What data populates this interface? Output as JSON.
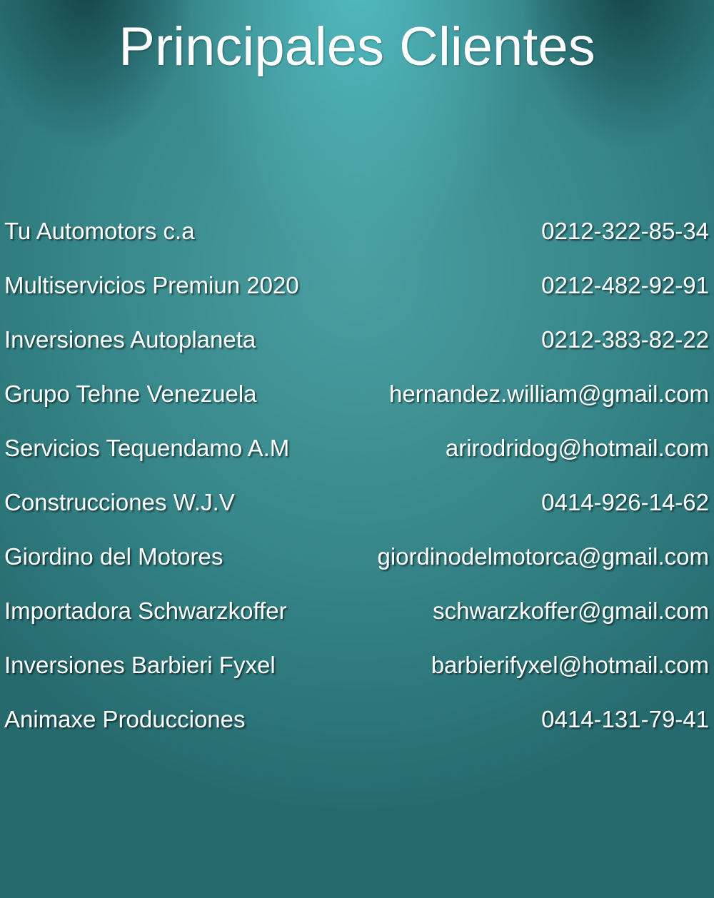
{
  "page": {
    "title": "Principales Clientes"
  },
  "clients": [
    {
      "name": "Tu Automotors c.a",
      "contact": "0212-322-85-34"
    },
    {
      "name": "Multiservicios Premiun 2020",
      "contact": "0212-482-92-91"
    },
    {
      "name": "Inversiones Autoplaneta",
      "contact": "0212-383-82-22"
    },
    {
      "name": "Grupo Tehne Venezuela",
      "contact": "hernandez.william@gmail.com"
    },
    {
      "name": "Servicios Tequendamo A.M",
      "contact": "arirodridog@hotmail.com"
    },
    {
      "name": "Construcciones W.J.V",
      "contact": "0414-926-14-62"
    },
    {
      "name": "Giordino del Motores",
      "contact": "giordinodelmotorca@gmail.com"
    },
    {
      "name": "Importadora Schwarzkoffer",
      "contact": "schwarzkoffer@gmail.com"
    },
    {
      "name": "Inversiones Barbieri Fyxel",
      "contact": "barbierifyxel@hotmail.com"
    },
    {
      "name": "Animaxe Producciones",
      "contact": "0414-131-79-41"
    }
  ],
  "colors": {
    "text": "#ffffff",
    "background": "#3a8a8d"
  }
}
